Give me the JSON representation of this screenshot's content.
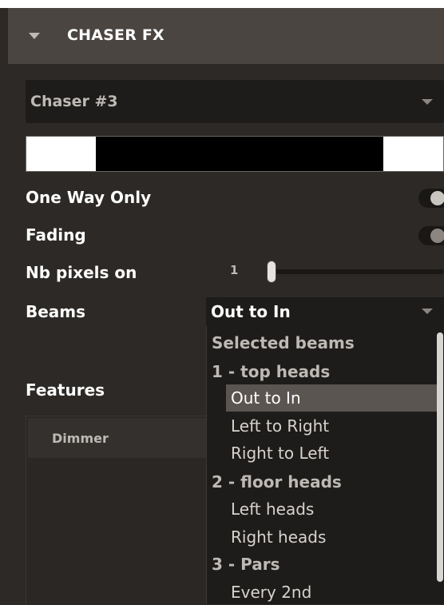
{
  "header": {
    "title": "CHASER FX"
  },
  "chaser": {
    "selected": "Chaser #3"
  },
  "options": [
    {
      "label": "One Way Only",
      "on": true
    },
    {
      "label": "Fading",
      "on": false
    }
  ],
  "nb_pixels": {
    "label": "Nb pixels on",
    "value": "1"
  },
  "beams": {
    "label": "Beams",
    "selected": "Out to In",
    "dropdown": {
      "heading": "Selected beams",
      "items": [
        {
          "text": "1 - top heads",
          "kind": "group"
        },
        {
          "text": "Out to In",
          "kind": "option",
          "selected": true
        },
        {
          "text": "Left to Right",
          "kind": "option"
        },
        {
          "text": "Right to Left",
          "kind": "option"
        },
        {
          "text": "2 - floor heads",
          "kind": "group"
        },
        {
          "text": "Left heads",
          "kind": "option"
        },
        {
          "text": "Right heads",
          "kind": "option"
        },
        {
          "text": "3 - Pars",
          "kind": "group"
        },
        {
          "text": "Every 2nd",
          "kind": "option"
        }
      ]
    }
  },
  "features": {
    "label": "Features",
    "rows": [
      "Dimmer"
    ]
  },
  "colors": {
    "header_bg": "#4a4541",
    "panel_bg": "#2c2926",
    "field_bg": "#1e1c1a",
    "highlight": "#5a5550"
  },
  "icons": {
    "collapse": "triangle-down-icon",
    "dropdown": "chevron-down-icon"
  }
}
